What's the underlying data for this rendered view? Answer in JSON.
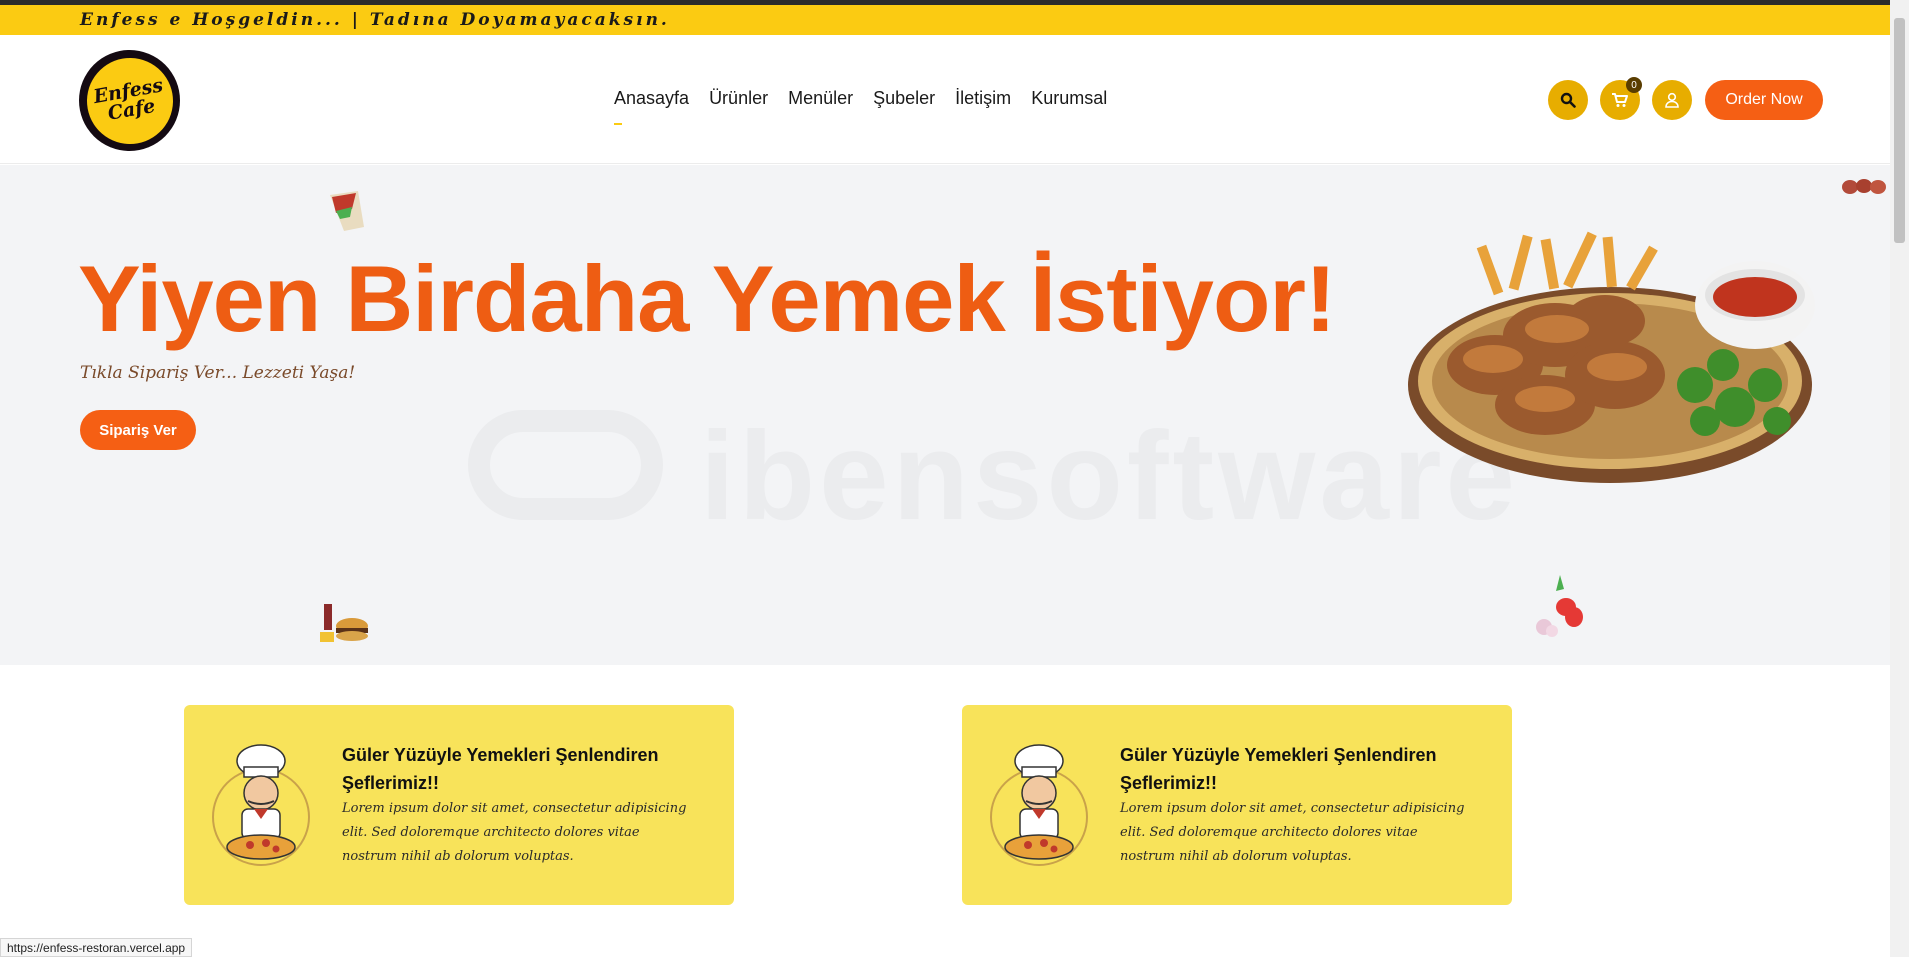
{
  "announcement": "Enfess e Hoşgeldin... | Tadına Doyamayacaksın.",
  "logo": {
    "line1": "Enfess",
    "line2": "Cafe"
  },
  "nav": [
    {
      "label": "Anasayfa"
    },
    {
      "label": "Ürünler"
    },
    {
      "label": "Menüler"
    },
    {
      "label": "Şubeler"
    },
    {
      "label": "İletişim"
    },
    {
      "label": "Kurumsal"
    }
  ],
  "header": {
    "cart_count": "0",
    "order_button": "Order Now"
  },
  "hero": {
    "title": "Yiyen Birdaha Yemek İstiyor!",
    "subtitle": "Tıkla Sipariş Ver... Lezzeti Yaşa!",
    "cta": "Sipariş Ver",
    "watermark": "ibensoftware"
  },
  "cards": [
    {
      "title": "Güler Yüzüyle Yemekleri Şenlendiren Şeflerimiz!!",
      "text": "Lorem ipsum dolor sit amet, consectetur adipisicing elit. Sed doloremque architecto dolores vitae nostrum nihil ab dolorum voluptas."
    },
    {
      "title": "Güler Yüzüyle Yemekleri Şenlendiren Şeflerimiz!!",
      "text": "Lorem ipsum dolor sit amet, consectetur adipisicing elit. Sed doloremque architecto dolores vitae nostrum nihil ab dolorum voluptas."
    }
  ],
  "status_url": "https://enfess-restoran.vercel.app",
  "icons": [
    "search-icon",
    "cart-icon",
    "user-icon"
  ],
  "colors": {
    "yellow": "#fbcb12",
    "orange": "#f55f14",
    "card": "#f8e35a"
  }
}
